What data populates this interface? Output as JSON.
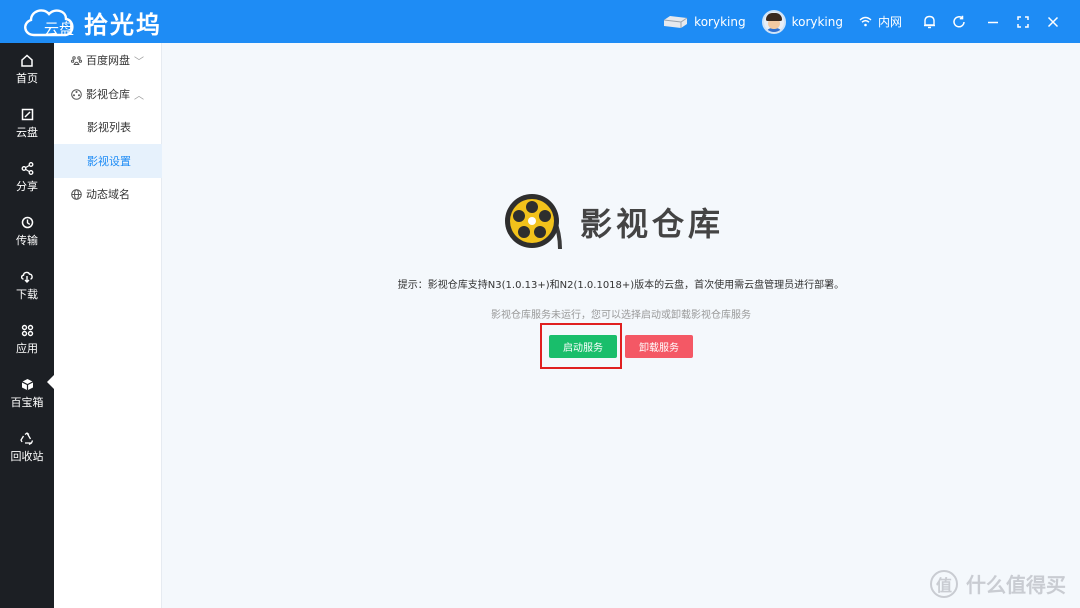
{
  "app": {
    "cloud_label": "云盘",
    "brand_name": "拾光坞",
    "colors": {
      "primary": "#1e8cf5",
      "rail": "#1c1f24",
      "success": "#19be6b",
      "danger": "#f45865",
      "highlight": "#e02020"
    }
  },
  "titlebar": {
    "device_name": "koryking",
    "user_name": "koryking",
    "network": "内网",
    "icons": [
      "device-icon",
      "wifi-icon",
      "bell-icon",
      "refresh-icon",
      "minimize-icon",
      "fullscreen-icon",
      "close-icon"
    ]
  },
  "rail": {
    "items": [
      {
        "label": "首页",
        "icon": "home-icon"
      },
      {
        "label": "云盘",
        "icon": "cloud-disk-icon"
      },
      {
        "label": "分享",
        "icon": "share-icon"
      },
      {
        "label": "传输",
        "icon": "transfer-icon"
      },
      {
        "label": "下载",
        "icon": "download-icon"
      },
      {
        "label": "应用",
        "icon": "apps-icon"
      },
      {
        "label": "百宝箱",
        "icon": "toolbox-icon"
      },
      {
        "label": "回收站",
        "icon": "recycle-icon"
      }
    ],
    "active": "应用"
  },
  "subnav": {
    "baidu": "百度网盘",
    "media": "影视仓库",
    "media_list": "影视列表",
    "media_settings": "影视设置",
    "ddns": "动态域名",
    "active": "影视设置"
  },
  "main": {
    "title": "影视仓库",
    "hint": "提示：影视仓库支持N3(1.0.13+)和N2(1.0.1018+)版本的云盘，首次使用需云盘管理员进行部署。",
    "status": "影视仓库服务未运行，您可以选择启动或卸载影视仓库服务",
    "start_button": "启动服务",
    "uninstall_button": "卸载服务"
  },
  "watermark": {
    "text": "什么值得买",
    "badge": "值"
  }
}
